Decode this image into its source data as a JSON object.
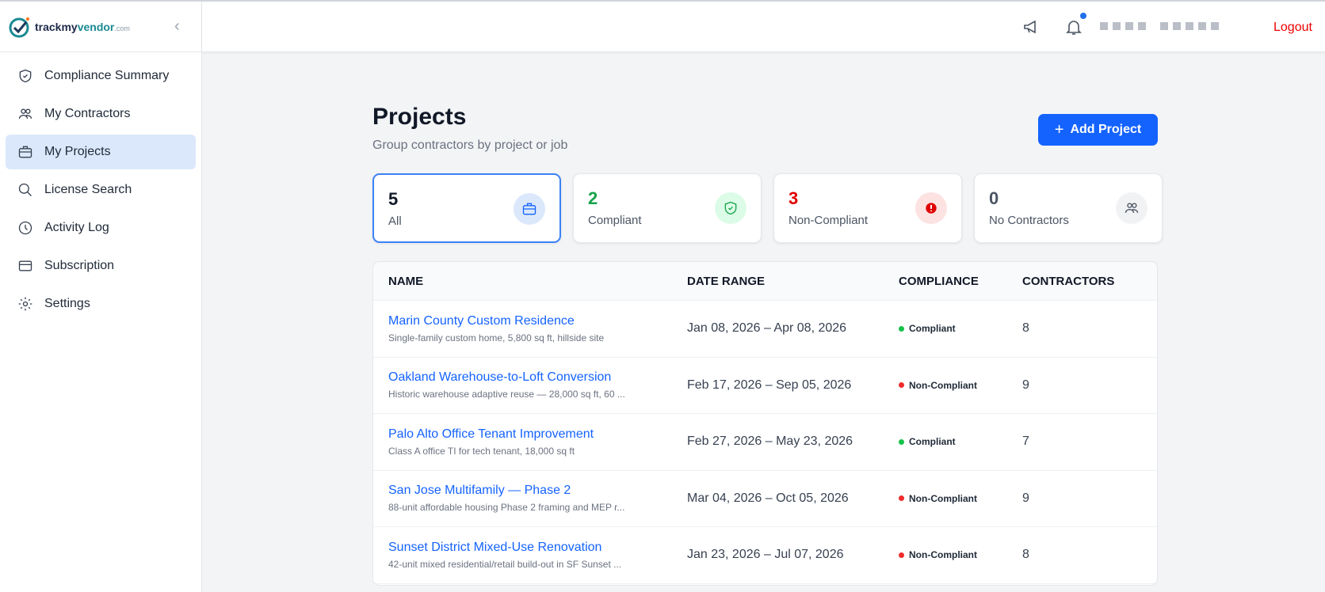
{
  "brand": {
    "name_part1": "trackmy",
    "name_part2": "vendor",
    "name_suffix": ".com"
  },
  "sidebar": {
    "items": [
      {
        "label": "Compliance Summary",
        "icon": "shield-icon"
      },
      {
        "label": "My Contractors",
        "icon": "users-icon"
      },
      {
        "label": "My Projects",
        "icon": "briefcase-icon",
        "active": true
      },
      {
        "label": "License Search",
        "icon": "search-icon"
      },
      {
        "label": "Activity Log",
        "icon": "clock-icon"
      },
      {
        "label": "Subscription",
        "icon": "credit-card-icon"
      },
      {
        "label": "Settings",
        "icon": "gear-icon"
      }
    ]
  },
  "topbar": {
    "logout": "Logout"
  },
  "page": {
    "title": "Projects",
    "subtitle": "Group contractors by project or job",
    "add_button": "Add Project"
  },
  "cards": [
    {
      "count": "5",
      "label": "All",
      "color": "#111827"
    },
    {
      "count": "2",
      "label": "Compliant",
      "color": "#16a34a"
    },
    {
      "count": "3",
      "label": "Non-Compliant",
      "color": "#e00000"
    },
    {
      "count": "0",
      "label": "No Contractors",
      "color": "#4b5563"
    }
  ],
  "table": {
    "headers": [
      "NAME",
      "DATE RANGE",
      "COMPLIANCE",
      "CONTRACTORS"
    ],
    "rows": [
      {
        "name": "Marin County Custom Residence",
        "desc": "Single-family custom home, 5,800 sq ft, hillside site",
        "dates": "Jan 08, 2026 – Apr 08, 2026",
        "status": "Compliant",
        "contractors": "8"
      },
      {
        "name": "Oakland Warehouse-to-Loft Conversion",
        "desc": "Historic warehouse adaptive reuse — 28,000 sq ft, 60 ...",
        "dates": "Feb 17, 2026 – Sep 05, 2026",
        "status": "Non-Compliant",
        "contractors": "9"
      },
      {
        "name": "Palo Alto Office Tenant Improvement",
        "desc": "Class A office TI for tech tenant, 18,000 sq ft",
        "dates": "Feb 27, 2026 – May 23, 2026",
        "status": "Compliant",
        "contractors": "7"
      },
      {
        "name": "San Jose Multifamily — Phase 2",
        "desc": "88-unit affordable housing Phase 2 framing and MEP r...",
        "dates": "Mar 04, 2026 – Oct 05, 2026",
        "status": "Non-Compliant",
        "contractors": "9"
      },
      {
        "name": "Sunset District Mixed-Use Renovation",
        "desc": "42-unit mixed residential/retail build-out in SF Sunset ...",
        "dates": "Jan 23, 2026 – Jul 07, 2026",
        "status": "Non-Compliant",
        "contractors": "8"
      }
    ]
  }
}
